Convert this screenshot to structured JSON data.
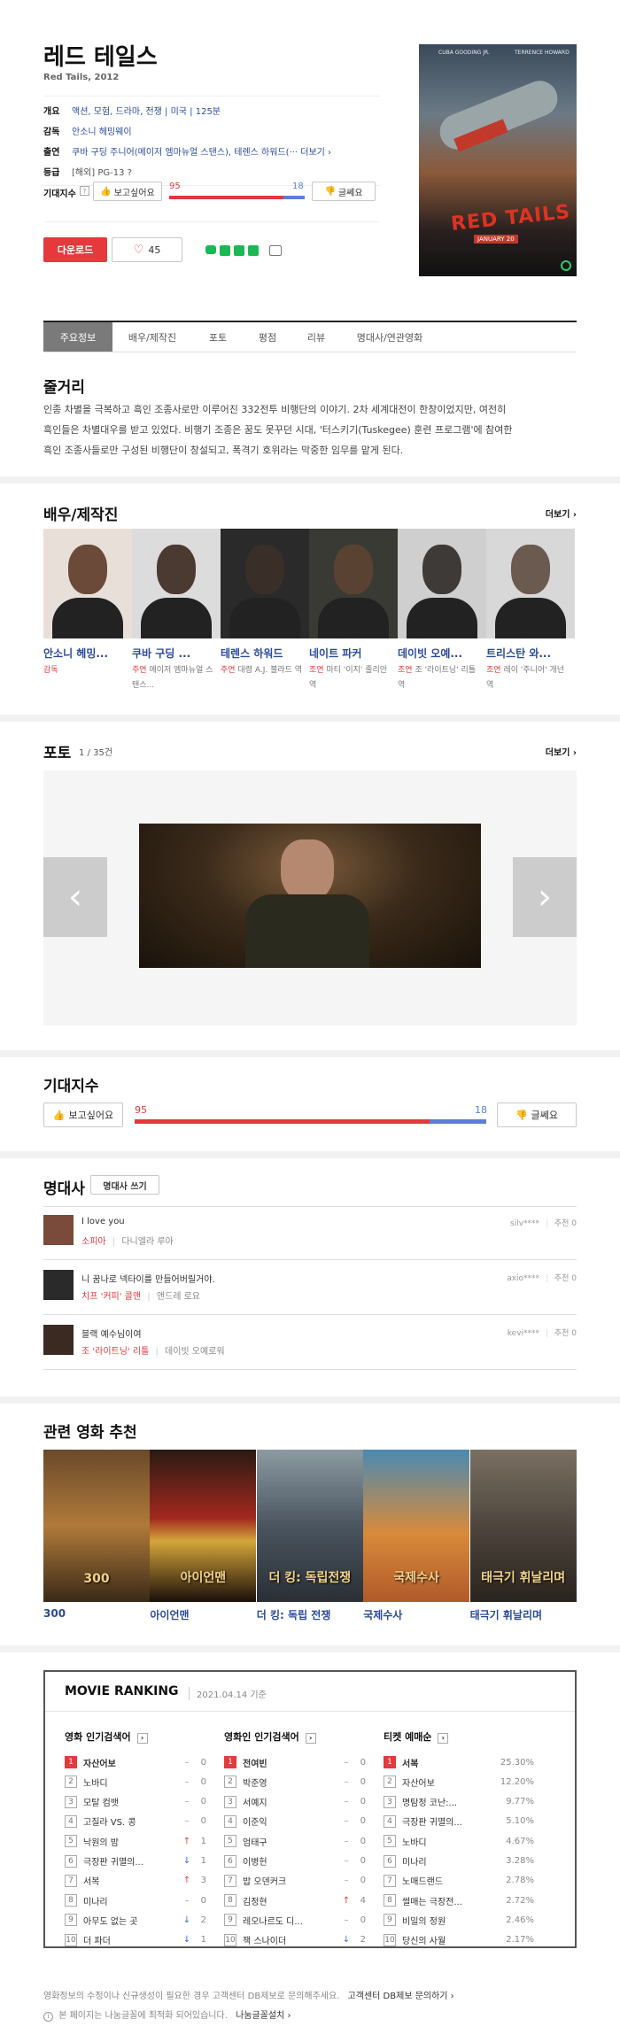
{
  "movie": {
    "title": "레드 테일스",
    "subtitle": "Red Tails, 2012",
    "info": [
      {
        "label": "개요",
        "value": "액션, 모험, 드라마, 전쟁 | 미국 | 125분"
      },
      {
        "label": "감독",
        "value": "안소니 헤밍웨이"
      },
      {
        "label": "출연",
        "value": "쿠바 구딩 주니어(메이저 엠마뉴얼 스탠스), 테렌스 하워드(···  더보기 ›"
      },
      {
        "label": "등급",
        "value": "[해외] PG-13 ?"
      }
    ],
    "expect_label": "기대지수",
    "want_label": "보고싶어요",
    "dislike_label": "글쎄요",
    "want_count": "95",
    "dislike_count": "18",
    "want_ratio": 0.84,
    "download_label": "다운로드",
    "like_count": "45",
    "poster_text": "RED TAILS",
    "poster_actor1": "CUBA GOODING JR.",
    "poster_actor2": "TERRENCE HOWARD",
    "poster_date": "JANUARY 20"
  },
  "tabs": [
    "주요정보",
    "배우/제작진",
    "포토",
    "평점",
    "리뷰",
    "명대사/연관영화"
  ],
  "synopsis": {
    "title": "줄거리",
    "lines": [
      "인종 차별을 극복하고 흑인 조종사로만 이루어진 332전투 비행단의 이야기. 2차 세계대전이 한창이었지만, 여전히",
      "흑인들은 차별대우를 받고 있었다. 비행기 조종은 꿈도 못꾸던 시대, '터스키기(Tuskegee) 훈련 프로그램'에 참여한",
      "흑인 조종사들로만 구성된 비행단이 창설되고, 폭격기 호위라는 막중한 임무를 맡게 된다."
    ]
  },
  "cast": {
    "title": "배우/제작진",
    "more": "더보기 ›",
    "people": [
      {
        "name": "안소니 헤밍...",
        "role": "감독",
        "role_detail": ""
      },
      {
        "name": "쿠바 구딩 ...",
        "role": "주연",
        "role_detail": "메이저 엠마뉴얼 스탠스..."
      },
      {
        "name": "테렌스 하워드",
        "role": "주연",
        "role_detail": "대령 A.J. 불라드 역"
      },
      {
        "name": "네이트 파커",
        "role": "조연",
        "role_detail": "마티 '이지' 줄리안 역"
      },
      {
        "name": "데이빗 오예...",
        "role": "조연",
        "role_detail": "조 '라이트닝' 리틀 역"
      },
      {
        "name": "트리스탄 와...",
        "role": "조연",
        "role_detail": "레이 '주니어' 개넌 역"
      }
    ]
  },
  "photo": {
    "title": "포토",
    "count": "1 / 35건",
    "more": "더보기 ›"
  },
  "expect2": {
    "title": "기대지수",
    "want_label": "보고싶어요",
    "dislike_label": "글쎄요",
    "want_count": "95",
    "dislike_count": "18"
  },
  "quotes": {
    "title": "명대사",
    "write_btn": "명대사 쓰기",
    "items": [
      {
        "text": "I love you",
        "char": "소피아",
        "actor": "다니엘라 루아",
        "user": "silv****",
        "rec": "추천 0"
      },
      {
        "text": "니 꿈나로 넥타이를 만들어버릴거야.",
        "char": "치프 '커피' 콜맨",
        "actor": "앤드레 로요",
        "user": "axio****",
        "rec": "추천 0"
      },
      {
        "text": "블랙 예수님이여",
        "char": "조 '라이트닝' 리틀",
        "actor": "데이빗 오예로워",
        "user": "kevi****",
        "rec": "추천 0"
      }
    ]
  },
  "related": {
    "title": "관련 영화 추천",
    "movies": [
      "300",
      "아이언맨",
      "더 킹: 독립 전쟁",
      "국제수사",
      "태극기 휘날리며"
    ],
    "poster_texts": [
      "300",
      "아이언맨",
      "더 킹: 독립전쟁",
      "국제수사",
      "태극기 휘날리며"
    ]
  },
  "ranking": {
    "title": "MOVIE RANKING",
    "date": "2021.04.14 기준",
    "columns": [
      {
        "title": "영화 인기검색어",
        "rows": [
          {
            "n": "1",
            "name": "자산어보",
            "ch": "–",
            "v": "0"
          },
          {
            "n": "2",
            "name": "노바디",
            "ch": "–",
            "v": "0"
          },
          {
            "n": "3",
            "name": "모탈 컴뱃",
            "ch": "–",
            "v": "0"
          },
          {
            "n": "4",
            "name": "고질라 VS. 콩",
            "ch": "–",
            "v": "0"
          },
          {
            "n": "5",
            "name": "낙원의 밤",
            "ch": "↑",
            "v": "1"
          },
          {
            "n": "6",
            "name": "극장판 귀멸의...",
            "ch": "↓",
            "v": "1"
          },
          {
            "n": "7",
            "name": "서복",
            "ch": "↑",
            "v": "3"
          },
          {
            "n": "8",
            "name": "미나리",
            "ch": "–",
            "v": "0"
          },
          {
            "n": "9",
            "name": "아무도 없는 곳",
            "ch": "↓",
            "v": "2"
          },
          {
            "n": "10",
            "name": "더 파더",
            "ch": "↓",
            "v": "1"
          }
        ]
      },
      {
        "title": "영화인 인기검색어",
        "rows": [
          {
            "n": "1",
            "name": "전여빈",
            "ch": "–",
            "v": "0"
          },
          {
            "n": "2",
            "name": "박준영",
            "ch": "–",
            "v": "0"
          },
          {
            "n": "3",
            "name": "서예지",
            "ch": "–",
            "v": "0"
          },
          {
            "n": "4",
            "name": "이준익",
            "ch": "–",
            "v": "0"
          },
          {
            "n": "5",
            "name": "엄태구",
            "ch": "–",
            "v": "0"
          },
          {
            "n": "6",
            "name": "이병헌",
            "ch": "–",
            "v": "0"
          },
          {
            "n": "7",
            "name": "밥 오덴커크",
            "ch": "–",
            "v": "0"
          },
          {
            "n": "8",
            "name": "김정현",
            "ch": "↑",
            "v": "4"
          },
          {
            "n": "9",
            "name": "레오나르도 디...",
            "ch": "–",
            "v": "0"
          },
          {
            "n": "10",
            "name": "잭 스나이더",
            "ch": "↓",
            "v": "2"
          }
        ]
      },
      {
        "title": "티켓 예매순",
        "rows": [
          {
            "n": "1",
            "name": "서복",
            "v": "25.30%"
          },
          {
            "n": "2",
            "name": "자산어보",
            "v": "12.20%"
          },
          {
            "n": "3",
            "name": "명탐정 코난:...",
            "v": "9.77%"
          },
          {
            "n": "4",
            "name": "극장판 귀멸의...",
            "v": "5.10%"
          },
          {
            "n": "5",
            "name": "노바디",
            "v": "4.67%"
          },
          {
            "n": "6",
            "name": "미나리",
            "v": "3.28%"
          },
          {
            "n": "7",
            "name": "노매드랜드",
            "v": "2.78%"
          },
          {
            "n": "8",
            "name": "썰매는 극장전...",
            "v": "2.72%"
          },
          {
            "n": "9",
            "name": "비밀의 정원",
            "v": "2.46%"
          },
          {
            "n": "10",
            "name": "당신의 사월",
            "v": "2.17%"
          }
        ]
      }
    ]
  },
  "footer": {
    "line1": "영화정보의 수정이나 신규생성이 필요한 경우 고객센터 DB제보로 문의해주세요.",
    "line1_link": "고객센터 DB제보 문의하기 ›",
    "line2": "본 페이지는 나눔글꼴에 최적화 되어있습니다.",
    "line2_link": "나눔글꼴설치 ›"
  },
  "colors": {
    "red": "#e5393c",
    "blue": "#5b7fd6",
    "link": "#2b4a9c"
  }
}
